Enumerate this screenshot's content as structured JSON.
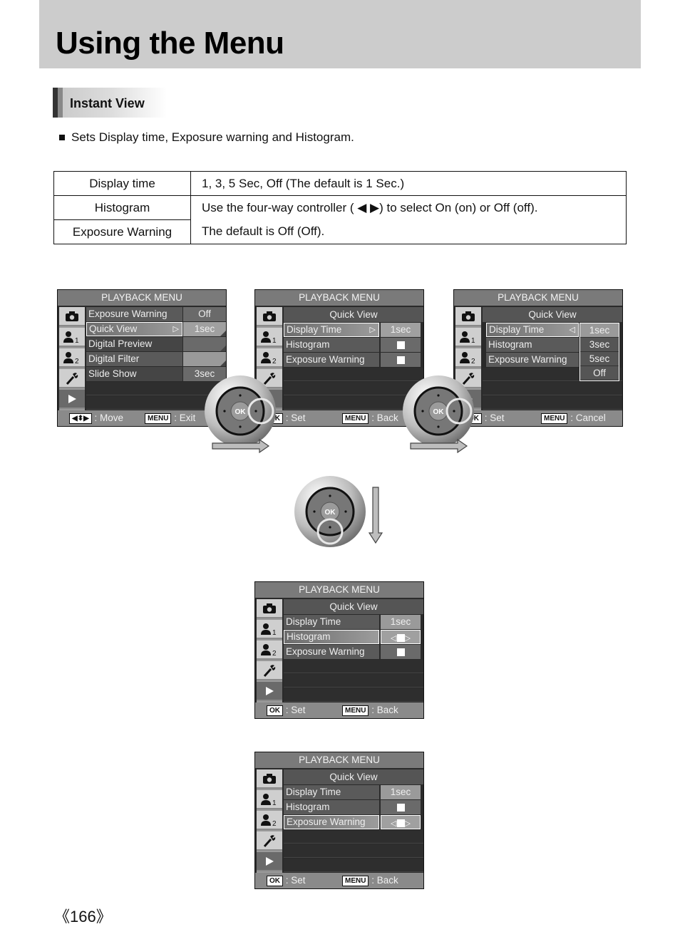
{
  "page": {
    "title": "Using the Menu",
    "section_title": "Instant View",
    "bullet": "Sets Display time, Exposure warning and Histogram.",
    "page_number": "《166》"
  },
  "spec_table": {
    "rows": [
      {
        "label": "Display time",
        "description": "1, 3, 5 Sec, Off (The default is 1 Sec.)"
      },
      {
        "label": "Histogram",
        "description": "Use the four-way controller ( ◀ ▶) to select On (on) or Off (off)."
      },
      {
        "label": "Exposure Warning",
        "description": "The default is Off (Off)."
      }
    ]
  },
  "screens": {
    "s1": {
      "title": "PLAYBACK MENU",
      "rows": [
        {
          "name": "Exposure Warning",
          "value": "Off"
        },
        {
          "name": "Quick View",
          "value": "1sec",
          "arrow": "▷"
        },
        {
          "name": "Digital Preview",
          "value": ""
        },
        {
          "name": "Digital Filter",
          "value": ""
        },
        {
          "name": "Slide Show",
          "value": "3sec"
        }
      ],
      "footer_left_key": "◀⬍▶",
      "footer_left": ": Move",
      "footer_right_key": "MENU",
      "footer_right": ": Exit"
    },
    "s2": {
      "title": "PLAYBACK MENU",
      "subtitle": "Quick View",
      "rows": [
        {
          "name": "Display Time",
          "value": "1sec",
          "arrow": "▷"
        },
        {
          "name": "Histogram",
          "value": "checkbox"
        },
        {
          "name": "Exposure Warning",
          "value": "checkbox"
        }
      ],
      "footer_left_key": "OK",
      "footer_left": ": Set",
      "footer_right_key": "MENU",
      "footer_right": ": Back"
    },
    "s3": {
      "title": "PLAYBACK MENU",
      "subtitle": "Quick View",
      "rows": [
        {
          "name": "Display Time",
          "arrow": "◁"
        },
        {
          "name": "Histogram"
        },
        {
          "name": "Exposure Warning"
        }
      ],
      "options": [
        "1sec",
        "3sec",
        "5sec",
        "Off"
      ],
      "selected_option": "1sec",
      "footer_left_key": "OK",
      "footer_left": ": Set",
      "footer_right_key": "MENU",
      "footer_right": ": Cancel"
    },
    "s4": {
      "title": "PLAYBACK MENU",
      "subtitle": "Quick View",
      "rows": [
        {
          "name": "Display Time",
          "value": "1sec"
        },
        {
          "name": "Histogram",
          "value": "◁ ▷"
        },
        {
          "name": "Exposure Warning",
          "value": "checkbox"
        }
      ],
      "footer_left_key": "OK",
      "footer_left": ": Set",
      "footer_right_key": "MENU",
      "footer_right": ": Back"
    },
    "s5": {
      "title": "PLAYBACK MENU",
      "subtitle": "Quick View",
      "rows": [
        {
          "name": "Display Time",
          "value": "1sec"
        },
        {
          "name": "Histogram",
          "value": "checkbox"
        },
        {
          "name": "Exposure Warning",
          "value": "◁ ▷"
        }
      ],
      "footer_left_key": "OK",
      "footer_left": ": Set",
      "footer_right_key": "MENU",
      "footer_right": ": Back"
    }
  },
  "sidebar_icons": [
    "camera-icon",
    "user-1-icon",
    "user-2-icon",
    "wrench-icon",
    "play-icon"
  ],
  "dial": {
    "center_label": "OK"
  },
  "colors": {
    "header_band": "#cccccc",
    "screen_bg": "#2a2a2a",
    "screen_title": "#7a7a7a"
  }
}
